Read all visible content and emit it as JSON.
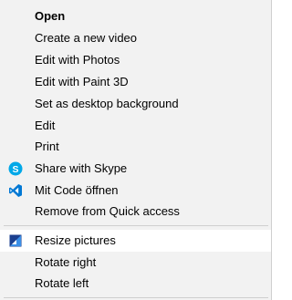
{
  "top_bleed_text": "…",
  "menu": {
    "items": [
      {
        "label": "Open",
        "bold": true
      },
      {
        "label": "Create a new video"
      },
      {
        "label": "Edit with Photos"
      },
      {
        "label": "Edit with Paint 3D"
      },
      {
        "label": "Set as desktop background"
      },
      {
        "label": "Edit"
      },
      {
        "label": "Print"
      },
      {
        "label": "Share with Skype",
        "icon": "skype-icon"
      },
      {
        "label": "Mit Code öffnen",
        "icon": "vscode-icon"
      },
      {
        "label": "Remove from Quick access"
      },
      {
        "label": "Resize pictures",
        "icon": "resize-pictures-icon"
      },
      {
        "label": "Rotate right"
      },
      {
        "label": "Rotate left"
      }
    ]
  },
  "colors": {
    "menu_background": "#f2f2f2",
    "highlight_background": "#ffffff",
    "skype_blue": "#00a8e8",
    "vscode_blue": "#0078d4",
    "separator": "#cfcfcf"
  }
}
